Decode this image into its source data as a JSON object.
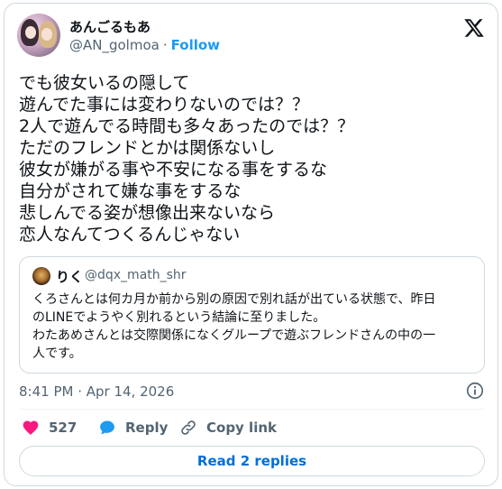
{
  "author": {
    "display_name": "あんごるもあ",
    "handle": "@AN_golmoa",
    "separator": "·",
    "follow_label": "Follow"
  },
  "tweet": {
    "lines": [
      "でも彼女いるの隠して",
      "遊んでた事には変わりないのでは？？",
      "2人で遊んでる時間も多々あったのでは？？",
      "ただのフレンドとかは関係ないし",
      "彼女が嫌がる事や不安になる事をするな",
      "自分がされて嫌な事をするな",
      "悲しんでる姿が想像出来ないなら",
      "恋人なんてつくるんじゃない"
    ],
    "timestamp": "8:41 PM · Apr 14, 2026"
  },
  "quote": {
    "display_name": "りく",
    "handle": "@dqx_math_shr",
    "lines": [
      "くろさんとは何カ月か前から別の原因で別れ話が出ている状態で、昨日",
      "のLINEでようやく別れるという結論に至りました。",
      "わたあめさんとは交際関係になくグループで遊ぶフレンドさんの中の一",
      "人です。"
    ]
  },
  "actions": {
    "like_count": "527",
    "reply_label": "Reply",
    "copy_label": "Copy link"
  },
  "read_replies_label": "Read 2 replies",
  "colors": {
    "accent": "#1d9bf0",
    "like": "#f91880",
    "text": "#0f1419",
    "muted": "#536471",
    "border": "#cfd9de"
  },
  "icons": [
    "x-logo-icon",
    "info-icon",
    "heart-icon",
    "reply-bubble-icon",
    "link-icon"
  ]
}
